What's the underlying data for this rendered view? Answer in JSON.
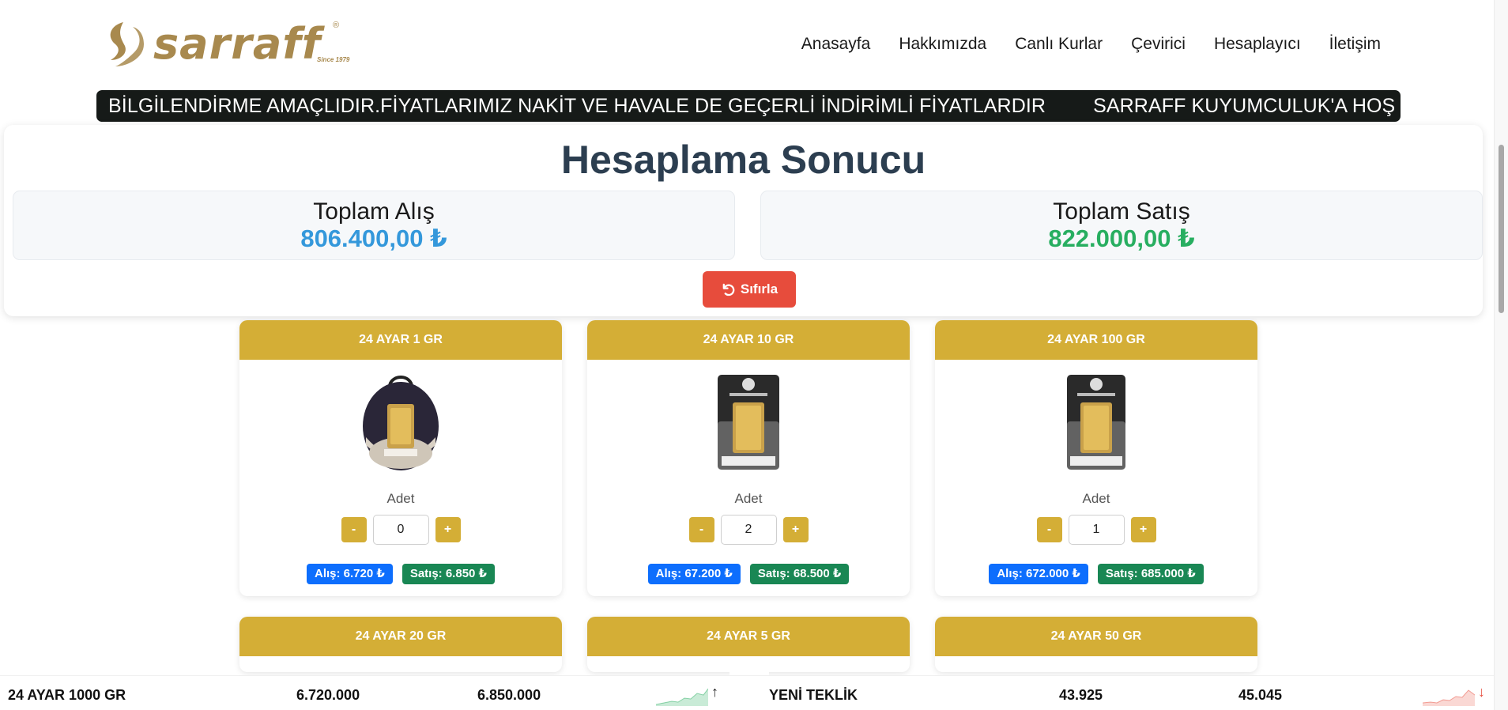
{
  "logo": {
    "word": "sarraff",
    "registered": "®",
    "since": "Since 1979",
    "color": "#a8894e"
  },
  "nav": [
    {
      "label": "Anasayfa"
    },
    {
      "label": "Hakkımızda"
    },
    {
      "label": "Canlı Kurlar"
    },
    {
      "label": "Çevirici"
    },
    {
      "label": "Hesaplayıcı"
    },
    {
      "label": "İletişim"
    }
  ],
  "marquee": {
    "text1": "BİLGİLENDİRME AMAÇLIDIR.FİYATLARIMIZ NAKİT VE HAVALE DE GEÇERLİ İNDİRİMLİ FİYATLARDIR",
    "text2": "SARRAFF KUYUMCULUK'A HOŞ"
  },
  "result": {
    "title": "Hesaplama Sonucu",
    "buy_label": "Toplam Alış",
    "buy_value": "806.400,00 ₺",
    "sell_label": "Toplam Satış",
    "sell_value": "822.000,00 ₺",
    "reset_label": "Sıfırla"
  },
  "cards": [
    {
      "title": "24 AYAR 1 GR",
      "adet_label": "Adet",
      "qty": "0",
      "minus": "-",
      "plus": "+",
      "alis": "Alış: 6.720 ₺",
      "satis": "Satış: 6.850 ₺"
    },
    {
      "title": "24 AYAR 10 GR",
      "adet_label": "Adet",
      "qty": "2",
      "minus": "-",
      "plus": "+",
      "alis": "Alış: 67.200 ₺",
      "satis": "Satış: 68.500 ₺"
    },
    {
      "title": "24 AYAR 100 GR",
      "adet_label": "Adet",
      "qty": "1",
      "minus": "-",
      "plus": "+",
      "alis": "Alış: 672.000 ₺",
      "satis": "Satış: 685.000 ₺"
    },
    {
      "title": "24 AYAR 20 GR"
    },
    {
      "title": "24 AYAR 5 GR"
    },
    {
      "title": "24 AYAR 50 GR"
    }
  ],
  "ticker": [
    {
      "name": "24 AYAR 1000 GR",
      "buy": "6.720.000",
      "sell": "6.850.000",
      "arrow": "↑",
      "trend_color": "#27ae60"
    },
    {
      "name": "YENİ TEKLİK",
      "buy": "43.925",
      "sell": "45.045",
      "arrow": "↓",
      "trend_color": "#e74c3c"
    }
  ],
  "colors": {
    "gold": "#d4ae36",
    "dark": "#161a18",
    "buy_blue": "#3498db",
    "sell_green": "#27ae60",
    "reset_red": "#e74c3c"
  }
}
